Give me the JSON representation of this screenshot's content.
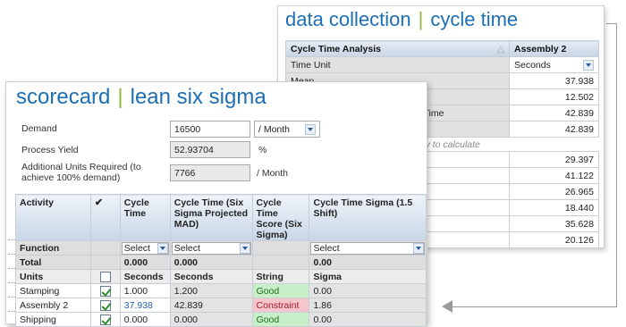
{
  "data_collection": {
    "title_left": "data collection",
    "title_sep": "|",
    "title_right": "cycle time",
    "header_col1": "Cycle Time Analysis",
    "header_col2": "Assembly 2",
    "time_unit_label": "Time Unit",
    "time_unit_value": "Seconds",
    "rows": [
      {
        "label": "Mean",
        "value": "37.938"
      },
      {
        "label": "",
        "value": "12.502"
      },
      {
        "label": "e Time",
        "value": "42.839"
      },
      {
        "label": "",
        "value": "42.839"
      }
    ],
    "hint": "key to calculate",
    "values2": [
      "29.397",
      "41.122",
      "26.965",
      "18.440",
      "35.628",
      "20.126"
    ]
  },
  "scorecard": {
    "title_left": "scorecard",
    "title_sep": "|",
    "title_right": "lean six sigma",
    "demand_label": "Demand",
    "demand_value": "16500",
    "demand_unit": "/ Month",
    "yield_label": "Process Yield",
    "yield_value": "52.93704",
    "yield_unit": "%",
    "additional_label": "Additional Units Required (to achieve 100% demand)",
    "additional_value": "7766",
    "additional_unit": "/ Month",
    "columns": [
      "Activity",
      "✔",
      "Cycle Time",
      "Cycle Time (Six Sigma Projected MAD)",
      "Cycle Time Score (Six Sigma)",
      "Cycle Time Sigma (1.5 Shift)"
    ],
    "function_row": {
      "label": "Function",
      "sel1": "Select",
      "sel2": "Select",
      "sel3": "Select"
    },
    "total_row": {
      "label": "Total",
      "c1": "0.000",
      "c2": "0.000",
      "c3": "0.00"
    },
    "units_row": {
      "label": "Units",
      "c1": "Seconds",
      "c2": "Seconds",
      "c3": "String",
      "c4": "Sigma"
    },
    "rows": [
      {
        "activity": "Stamping",
        "cycle": "1.000",
        "mad": "1.200",
        "score": "Good",
        "sigma": "0.00"
      },
      {
        "activity": "Assembly 2",
        "cycle": "37.938",
        "mad": "42.839",
        "score": "Constraint",
        "sigma": "1.86"
      },
      {
        "activity": "Shipping",
        "cycle": "0.000",
        "mad": "0.000",
        "score": "Good",
        "sigma": "0.00"
      }
    ]
  }
}
